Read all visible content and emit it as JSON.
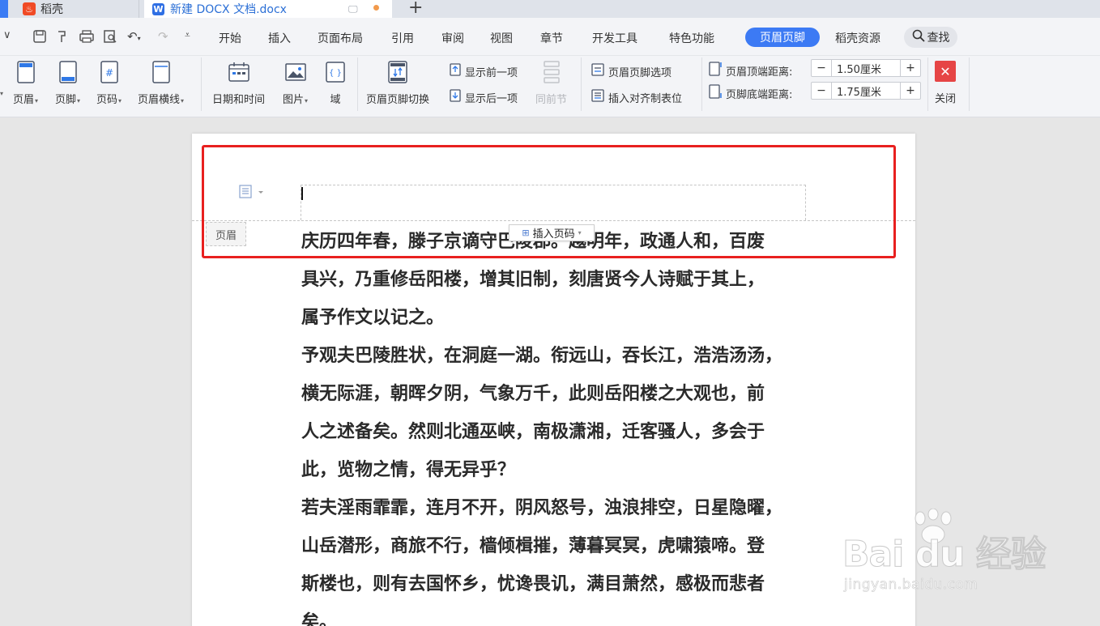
{
  "tabs": {
    "home_label": "稻壳",
    "doc_label": "新建 DOCX 文档.docx",
    "add_tab": "+"
  },
  "menu": {
    "items": [
      "开始",
      "插入",
      "页面布局",
      "引用",
      "审阅",
      "视图",
      "章节",
      "开发工具",
      "特色功能"
    ],
    "active": "页眉页脚",
    "after_active": "稻壳资源",
    "search": "查找"
  },
  "ribbon": {
    "header": "页眉",
    "footer": "页脚",
    "page_number": "页码",
    "header_line": "页眉横线",
    "date_time": "日期和时间",
    "picture": "图片",
    "field": "域",
    "switch": "页眉页脚切换",
    "show_prev": "显示前一项",
    "show_next": "显示后一项",
    "same_as_prev": "同前节",
    "options": "页眉页脚选项",
    "insert_align_tab": "插入对齐制表位",
    "top_distance_label": "页眉顶端距离:",
    "top_distance_value": "1.50厘米",
    "bottom_distance_label": "页脚底端距离:",
    "bottom_distance_value": "1.75厘米",
    "minus": "−",
    "plus": "+",
    "close": "关闭"
  },
  "document": {
    "header_label": "页眉",
    "insert_page_number": "插入页码",
    "lines": [
      "庆历四年春，滕子京谪守巴陵郡。越明年，政通人和，百废",
      "具兴，乃重修岳阳楼，增其旧制，刻唐贤今人诗赋于其上，",
      "属予作文以记之。",
      "予观夫巴陵胜状，在洞庭一湖。衔远山，吞长江，浩浩汤汤，",
      "横无际涯，朝晖夕阴，气象万千，此则岳阳楼之大观也，前",
      "人之述备矣。然则北通巫峡，南极潇湘，迁客骚人，多会于",
      "此，览物之情，得无异乎？",
      "若夫淫雨霏霏，连月不开，阴风怒号，浊浪排空，日星隐曜，",
      "山岳潜形，商旅不行，樯倾楫摧，薄暮冥冥，虎啸猿啼。登",
      "斯楼也，则有去国怀乡，忧谗畏讥，满目萧然，感极而悲者",
      "矣。"
    ]
  },
  "watermark": {
    "main": "Bai du 经验",
    "sub": "jingyan.baidu.com"
  },
  "colors": {
    "accent": "#3c7af4",
    "highlight_box": "#e8201f",
    "close": "#e64545"
  }
}
